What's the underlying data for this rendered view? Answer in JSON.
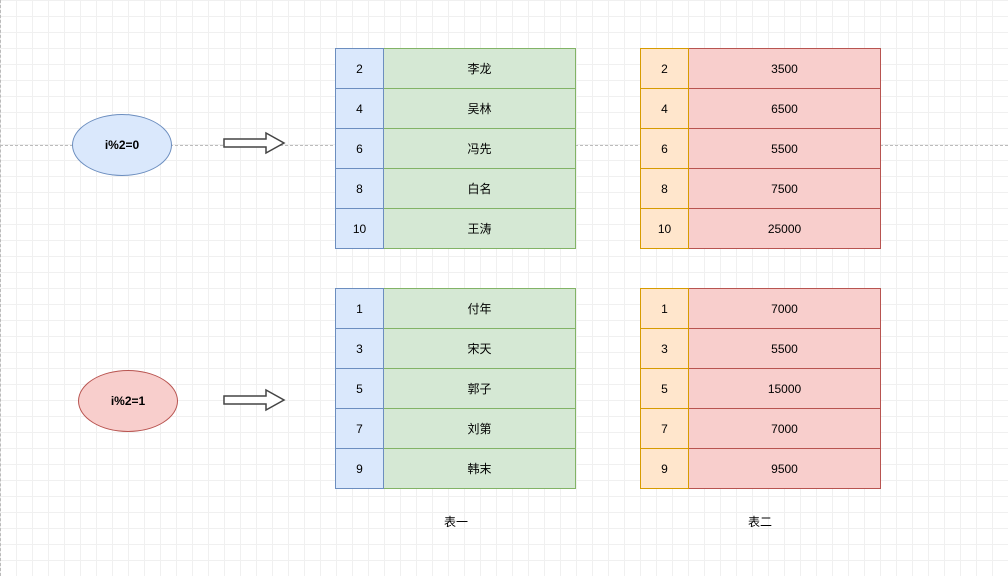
{
  "condition_even": "i%2=0",
  "condition_odd": "i%2=1",
  "table1": {
    "caption": "表一",
    "even": [
      {
        "idx": "2",
        "name": "李龙"
      },
      {
        "idx": "4",
        "name": "吴林"
      },
      {
        "idx": "6",
        "name": "冯先"
      },
      {
        "idx": "8",
        "name": "白名"
      },
      {
        "idx": "10",
        "name": "王涛"
      }
    ],
    "odd": [
      {
        "idx": "1",
        "name": "付年"
      },
      {
        "idx": "3",
        "name": "宋天"
      },
      {
        "idx": "5",
        "name": "郭子"
      },
      {
        "idx": "7",
        "name": "刘第"
      },
      {
        "idx": "9",
        "name": "韩末"
      }
    ]
  },
  "table2": {
    "caption": "表二",
    "even": [
      {
        "idx": "2",
        "val": "3500"
      },
      {
        "idx": "4",
        "val": "6500"
      },
      {
        "idx": "6",
        "val": "5500"
      },
      {
        "idx": "8",
        "val": "7500"
      },
      {
        "idx": "10",
        "val": "25000"
      }
    ],
    "odd": [
      {
        "idx": "1",
        "val": "7000"
      },
      {
        "idx": "3",
        "val": "5500"
      },
      {
        "idx": "5",
        "val": "15000"
      },
      {
        "idx": "7",
        "val": "7000"
      },
      {
        "idx": "9",
        "val": "9500"
      }
    ]
  }
}
